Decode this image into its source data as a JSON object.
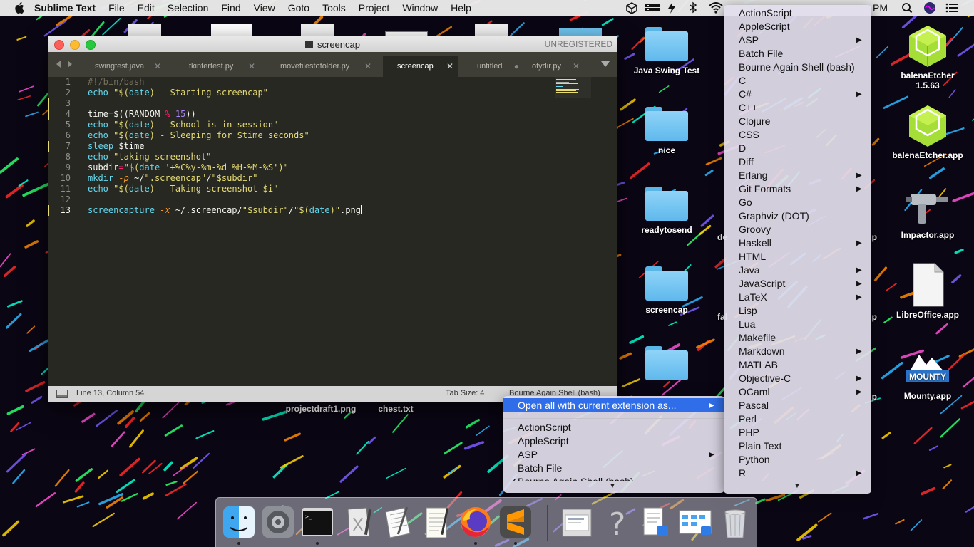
{
  "menubar": {
    "app_name": "Sublime Text",
    "items": [
      "File",
      "Edit",
      "Selection",
      "Find",
      "View",
      "Goto",
      "Tools",
      "Project",
      "Window",
      "Help"
    ],
    "clock_fragment": "PM"
  },
  "desktop_icons": {
    "java_swing_test": "Java Swing Test",
    "nice": "nice",
    "readytosend": "readytosend",
    "screencap": "screencap",
    "balena_etcher_1": "balenaEtcher",
    "balena_etcher_1_version": "1.5.63",
    "balena_etcher_app": "balenaEtcher.app",
    "impactor": "Impactor.app",
    "libreoffice": "LibreOffice.app",
    "mounty": "Mounty.app",
    "mounty_logo_text": "MOUNTY",
    "projectdraft": "projectdraft1.png",
    "chest": "chest.txt",
    "partial_labels": [
      "de",
      "fal",
      "p",
      "p",
      "p",
      "p"
    ]
  },
  "window": {
    "title": "screencap",
    "unregistered": "UNREGISTERED",
    "tabs": [
      {
        "label": "swingtest.java",
        "active": false,
        "dirty": false
      },
      {
        "label": "tkintertest.py",
        "active": false,
        "dirty": false
      },
      {
        "label": "movefilestofolder.py",
        "active": false,
        "dirty": false
      },
      {
        "label": "screencap",
        "active": true,
        "dirty": false
      },
      {
        "label": "untitled",
        "active": false,
        "dirty": true
      },
      {
        "label": "otydir.py",
        "active": false,
        "dirty": false
      }
    ],
    "code_lines": [
      {
        "n": "1",
        "text": "#!/bin/bash"
      },
      {
        "n": "2",
        "text": "echo \"$(date) - Starting screencap\""
      },
      {
        "n": "3",
        "text": ""
      },
      {
        "n": "4",
        "text": "time=$((RANDOM % 15))"
      },
      {
        "n": "5",
        "text": "echo \"$(date) - School is in session\""
      },
      {
        "n": "6",
        "text": "echo \"$(date) - Sleeping for $time seconds\""
      },
      {
        "n": "7",
        "text": "sleep $time"
      },
      {
        "n": "8",
        "text": "echo \"taking screenshot\""
      },
      {
        "n": "9",
        "text": "subdir=\"$(date '+%C%y-%m-%d %H-%M-%S')\""
      },
      {
        "n": "10",
        "text": "mkdir -p ~/\".screencap\"/\"$subdir\""
      },
      {
        "n": "11",
        "text": "echo \"$(date) - Taking screenshot $i\""
      },
      {
        "n": "12",
        "text": ""
      },
      {
        "n": "13",
        "text": "screencapture -x ~/.screencap/\"$subdir\"/\"$(date)\".png"
      }
    ],
    "status": {
      "position": "Line 13, Column 54",
      "tab_size": "Tab Size: 4",
      "syntax": "Bourne Again Shell (bash)"
    }
  },
  "syntax_menu_right": {
    "items": [
      {
        "label": "ActionScript",
        "sub": false
      },
      {
        "label": "AppleScript",
        "sub": false
      },
      {
        "label": "ASP",
        "sub": true
      },
      {
        "label": "Batch File",
        "sub": false
      },
      {
        "label": "Bourne Again Shell (bash)",
        "sub": false
      },
      {
        "label": "C",
        "sub": false
      },
      {
        "label": "C#",
        "sub": true
      },
      {
        "label": "C++",
        "sub": false
      },
      {
        "label": "Clojure",
        "sub": false
      },
      {
        "label": "CSS",
        "sub": false
      },
      {
        "label": "D",
        "sub": false
      },
      {
        "label": "Diff",
        "sub": false
      },
      {
        "label": "Erlang",
        "sub": true
      },
      {
        "label": "Git Formats",
        "sub": true
      },
      {
        "label": "Go",
        "sub": false
      },
      {
        "label": "Graphviz (DOT)",
        "sub": false
      },
      {
        "label": "Groovy",
        "sub": false
      },
      {
        "label": "Haskell",
        "sub": true
      },
      {
        "label": "HTML",
        "sub": false
      },
      {
        "label": "Java",
        "sub": true
      },
      {
        "label": "JavaScript",
        "sub": true
      },
      {
        "label": "LaTeX",
        "sub": true
      },
      {
        "label": "Lisp",
        "sub": false
      },
      {
        "label": "Lua",
        "sub": false
      },
      {
        "label": "Makefile",
        "sub": false
      },
      {
        "label": "Markdown",
        "sub": true
      },
      {
        "label": "MATLAB",
        "sub": false
      },
      {
        "label": "Objective-C",
        "sub": true
      },
      {
        "label": "OCaml",
        "sub": true
      },
      {
        "label": "Pascal",
        "sub": false
      },
      {
        "label": "Perl",
        "sub": false
      },
      {
        "label": "PHP",
        "sub": false
      },
      {
        "label": "Plain Text",
        "sub": false
      },
      {
        "label": "Python",
        "sub": false
      },
      {
        "label": "R",
        "sub": true
      }
    ]
  },
  "syntax_menu_left": {
    "header": "Open all with current extension as...",
    "items": [
      {
        "label": "ActionScript",
        "sub": false
      },
      {
        "label": "AppleScript",
        "sub": false
      },
      {
        "label": "ASP",
        "sub": true
      },
      {
        "label": "Batch File",
        "sub": false
      },
      {
        "label": "Bourne Again Shell (bash)",
        "sub": false,
        "checked": true
      }
    ]
  },
  "colors": {
    "editor_bg": "#272822",
    "menu_highlight": "#2f6ee8",
    "accent_keyword": "#66d9ef",
    "accent_string": "#e6db74"
  },
  "dock": {
    "apps": [
      "finder-icon",
      "system-preferences-icon",
      "terminal-icon",
      "script-editor-icon",
      "textedit-icon",
      "preview-icon",
      "firefox-icon",
      "sublime-text-icon",
      "document-viewer-icon",
      "help-icon",
      "file-icon",
      "screenshot-icon",
      "trash-icon"
    ]
  }
}
